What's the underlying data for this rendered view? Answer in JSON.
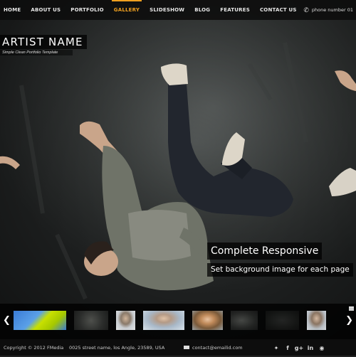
{
  "nav": {
    "items": [
      {
        "label": "HOME"
      },
      {
        "label": "ABOUT US"
      },
      {
        "label": "PORTFOLIO"
      },
      {
        "label": "GALLERY"
      },
      {
        "label": "SLIDESHOW"
      },
      {
        "label": "BLOG"
      },
      {
        "label": "FEATURES"
      },
      {
        "label": "CONTACT US"
      }
    ],
    "active": "GALLERY",
    "phone_icon": "phone-icon",
    "phone_text": "phone number 01"
  },
  "brand": {
    "name": "ARTIST  NAME",
    "tagline": "Simple Clean Portfolio Template"
  },
  "slide": {
    "title": "Complete Responsive",
    "subtitle": "Set background image for each page"
  },
  "thumbnails": {
    "prev_icon": "chevron-left-icon",
    "next_icon": "chevron-right-icon",
    "toggle_icon": "thumbnail-toggle-icon",
    "items": [
      {
        "name": "thumb-yellow-fabric"
      },
      {
        "name": "thumb-dancer-grey"
      },
      {
        "name": "thumb-portrait-man"
      },
      {
        "name": "thumb-portrait-glasses"
      },
      {
        "name": "thumb-portrait-woman"
      },
      {
        "name": "thumb-dark-figure"
      },
      {
        "name": "thumb-dark-scene"
      },
      {
        "name": "thumb-portrait-man-2"
      }
    ]
  },
  "footer": {
    "copyright": "Copyright © 2012 FMedia",
    "address": "0025 street name, los Angle, 23589, USA",
    "email": "contact@emailid.com",
    "social": [
      "twitter-icon",
      "facebook-icon",
      "google-plus-icon",
      "linkedin-icon",
      "rss-icon"
    ]
  },
  "colors": {
    "accent": "#f0a020",
    "bar_bg": "#0d0d0d",
    "backdrop": "#454948"
  }
}
